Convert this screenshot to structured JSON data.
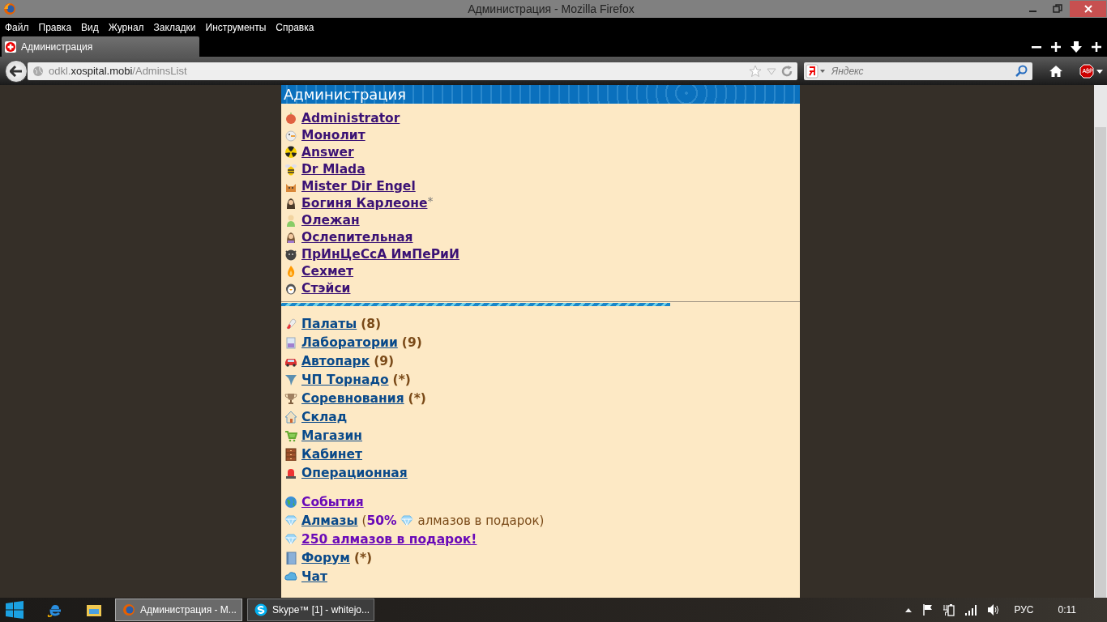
{
  "window": {
    "title": "Администрация - Mozilla Firefox"
  },
  "menu": [
    "Файл",
    "Правка",
    "Вид",
    "Журнал",
    "Закладки",
    "Инструменты",
    "Справка"
  ],
  "tabs": [
    {
      "label": "Администрация",
      "selected": true
    }
  ],
  "address": {
    "prefix": "odkl.",
    "domain": "xospital.mobi",
    "path": "/AdminsList"
  },
  "search": {
    "placeholder": "Яндекс"
  },
  "page": {
    "heading": "Администрация",
    "admins": [
      {
        "name": "Administrator"
      },
      {
        "name": "Монолит"
      },
      {
        "name": "Answer"
      },
      {
        "name": "Dr Mlada"
      },
      {
        "name": "Mister Dir Engel"
      },
      {
        "name": "Богиня Карлеоне",
        "mark": "*"
      },
      {
        "name": "Олежан"
      },
      {
        "name": "Ослепительная"
      },
      {
        "name": "ПрИнЦеСсА ИмПеРиИ"
      },
      {
        "name": "Сехмет"
      },
      {
        "name": "Стэйси"
      }
    ],
    "sections": [
      {
        "items": [
          {
            "kind": "plain",
            "label": "Палаты",
            "suffix": "(8)"
          },
          {
            "kind": "plain",
            "label": "Лаборатории",
            "suffix": "(9)"
          },
          {
            "kind": "plain",
            "label": "Автопарк",
            "suffix": "(9)"
          },
          {
            "kind": "plain",
            "label": "ЧП Торнадо",
            "suffix": "(*)"
          },
          {
            "kind": "plain",
            "label": "Соревнования",
            "suffix": "(*)"
          },
          {
            "kind": "plain",
            "label": "Склад"
          },
          {
            "kind": "plain",
            "label": "Магазин"
          },
          {
            "kind": "plain",
            "label": "Кабинет"
          },
          {
            "kind": "plain",
            "label": "Операционная"
          }
        ]
      },
      {
        "items": [
          {
            "kind": "promo",
            "label": "События"
          },
          {
            "kind": "offer",
            "label": "Алмазы",
            "open": "(",
            "percent": "50%",
            "note": "алмазов в подарок)"
          },
          {
            "kind": "promo",
            "label": "250 алмазов в подарок!"
          },
          {
            "kind": "plain",
            "label": "Форум",
            "suffix": "(*)"
          },
          {
            "kind": "plain",
            "label": "Чат"
          }
        ]
      }
    ]
  },
  "taskbar": {
    "items": [
      {
        "label": "Администрация - M...",
        "selected": true
      },
      {
        "label": "Skype™ [1] - whitejo...",
        "selected": false
      }
    ],
    "language": "РУС",
    "time": "0:11"
  }
}
